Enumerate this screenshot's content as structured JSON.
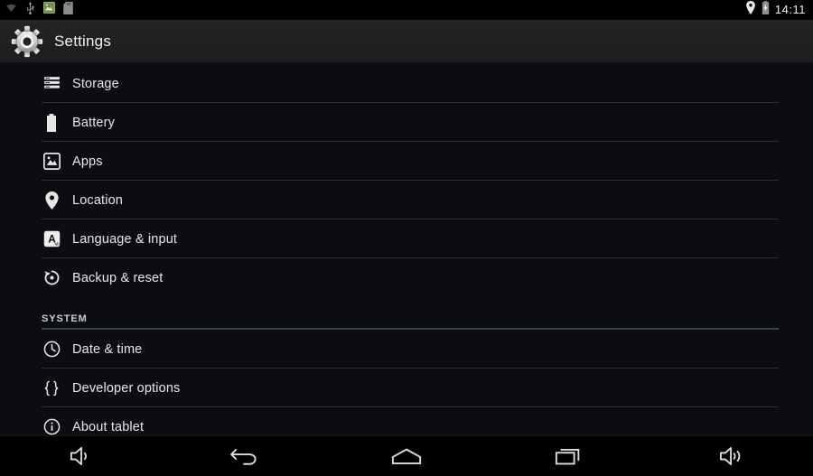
{
  "status_bar": {
    "left_icons": [
      {
        "name": "wifi-icon",
        "label": "Wi-Fi"
      },
      {
        "name": "usb-icon",
        "label": "USB connected"
      },
      {
        "name": "screenshot-icon",
        "label": "Screenshot captured"
      },
      {
        "name": "sd-card-icon",
        "label": "SD card"
      }
    ],
    "right_icons": [
      {
        "name": "location-icon",
        "label": "Location on"
      },
      {
        "name": "battery-charging-icon",
        "label": "Battery charging"
      }
    ],
    "clock": "14:11"
  },
  "action_bar": {
    "icon": "settings-gear-icon",
    "title": "Settings"
  },
  "settings_list": [
    {
      "icon": "storage-icon",
      "label": "Storage",
      "type": "item"
    },
    {
      "icon": "battery-icon",
      "label": "Battery",
      "type": "item"
    },
    {
      "icon": "apps-icon",
      "label": "Apps",
      "type": "item"
    },
    {
      "icon": "location-pin-icon",
      "label": "Location",
      "type": "item"
    },
    {
      "icon": "language-icon",
      "label": "Language & input",
      "type": "item"
    },
    {
      "icon": "backup-reset-icon",
      "label": "Backup & reset",
      "type": "item-last-before-header"
    },
    {
      "label": "SYSTEM",
      "type": "section"
    },
    {
      "icon": "clock-icon",
      "label": "Date & time",
      "type": "item"
    },
    {
      "icon": "braces-icon",
      "label": "Developer options",
      "type": "item"
    },
    {
      "icon": "info-icon",
      "label": "About tablet",
      "type": "item"
    }
  ],
  "nav_bar": [
    {
      "icon": "volume-down-icon",
      "label": "Volume down"
    },
    {
      "icon": "back-icon",
      "label": "Back"
    },
    {
      "icon": "home-icon",
      "label": "Home"
    },
    {
      "icon": "recent-apps-icon",
      "label": "Recent apps"
    },
    {
      "icon": "volume-up-icon",
      "label": "Volume up"
    }
  ],
  "colors": {
    "background": "#0b0d10",
    "action_bar": "#222222",
    "divider": "#2a2f36",
    "section_divider": "#3d444d",
    "text_primary": "#e8e8e8",
    "text_section": "#c9ced4",
    "screenshot_icon_accent": "#7a9b4e"
  }
}
